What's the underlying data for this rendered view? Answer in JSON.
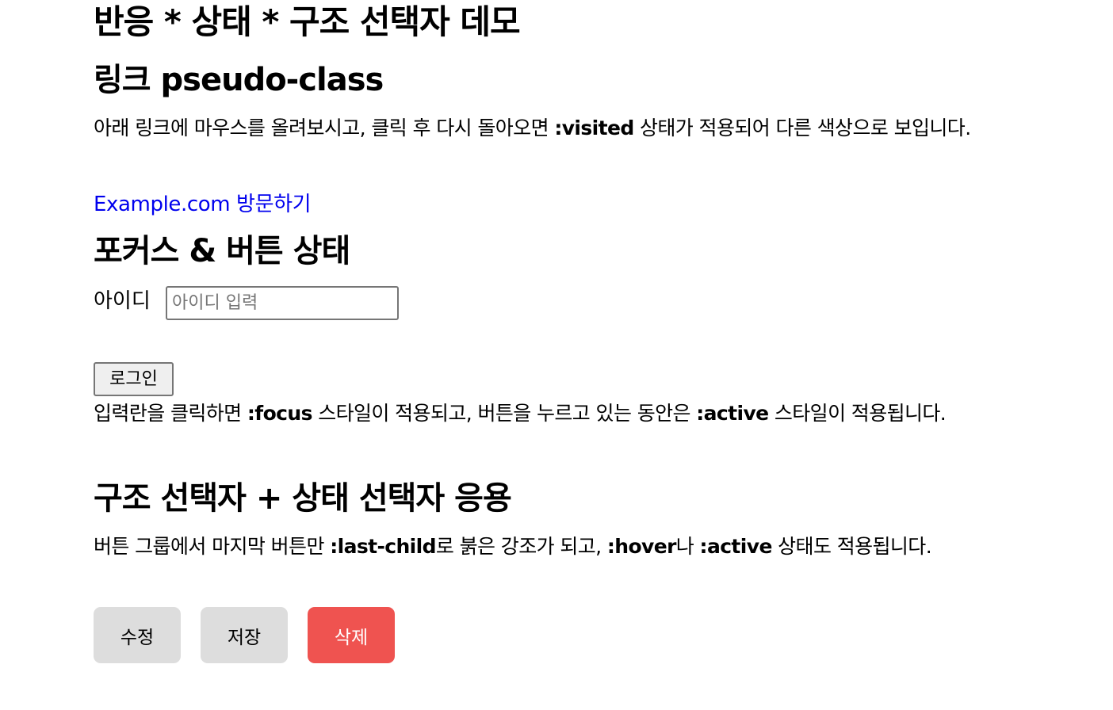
{
  "page": {
    "title": "반응 * 상태 * 구조 선택자 데모"
  },
  "section_link": {
    "heading": "링크 pseudo-class",
    "desc_before": "아래 링크에 마우스를 올려보시고, 클릭 후 다시 돌아오면 ",
    "desc_code": ":visited",
    "desc_after": " 상태가 적용되어 다른 색상으로 보입니다.",
    "link_text": "Example.com 방문하기",
    "link_color": "#0000ee"
  },
  "section_focus": {
    "heading": "포커스 & 버튼 상태",
    "id_label": "아이디",
    "id_input": {
      "value": "",
      "placeholder": "아이디 입력"
    },
    "login_label": "로그인",
    "desc_before": "입력란을 클릭하면 ",
    "desc_code1": ":focus",
    "desc_mid": " 스타일이 적용되고, 버튼을 누르고 있는 동안은 ",
    "desc_code2": ":active",
    "desc_after": " 스타일이 적용됩니다."
  },
  "section_structure": {
    "heading": "구조 선택자 + 상태 선택자 응용",
    "desc_before": "버튼 그룹에서 마지막 버튼만 ",
    "desc_code1": ":last-child",
    "desc_mid1": "로 붉은 강조가 되고, ",
    "desc_code2": ":hover",
    "desc_mid2": "나 ",
    "desc_code3": ":active",
    "desc_after": " 상태도 적용됩니다.",
    "buttons": [
      {
        "label": "수정"
      },
      {
        "label": "저장"
      },
      {
        "label": "삭제"
      }
    ],
    "button_color": "#dddddd",
    "danger_color": "#ef5350"
  }
}
